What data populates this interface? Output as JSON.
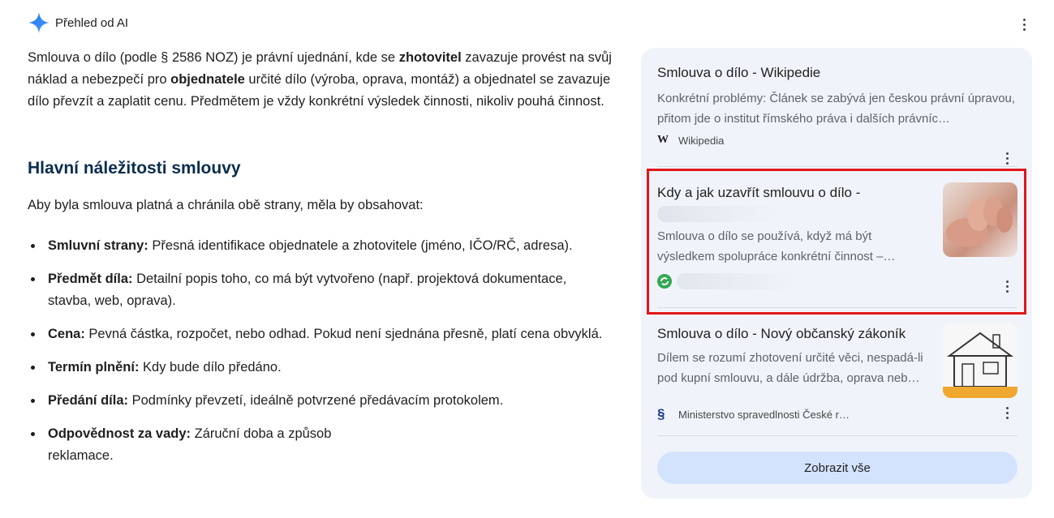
{
  "header": {
    "title": "Přehled od AI",
    "icon": "ai-sparkle-icon",
    "accent": "#4285f4"
  },
  "intro": {
    "p1": "Smlouva o dílo (podle § 2586 NOZ) je právní ujednání, kde se ",
    "b1": "zhotovitel",
    "p2": " zavazuje provést na svůj náklad a nebezpečí pro ",
    "b2": "objednatele",
    "p3": " určité dílo (výroba, oprava, montáž) a objednatel se zavazuje dílo převzít a zaplatit cenu. Předmětem je vždy konkrétní výsledek činnosti, nikoliv pouhá činnost."
  },
  "section": {
    "heading": "Hlavní náležitosti smlouvy",
    "subtitle": "Aby byla smlouva platná a chránila obě strany, měla by obsahovat:",
    "items": [
      {
        "term": "Smluvní strany:",
        "text": " Přesná identifikace objednatele a zhotovitele (jméno, IČO/RČ, adresa)."
      },
      {
        "term": "Předmět díla:",
        "text": " Detailní popis toho, co má být vytvořeno (např. projektová dokumentace, stavba, web, oprava)."
      },
      {
        "term": "Cena:",
        "text": " Pevná částka, rozpočet, nebo odhad. Pokud není sjednána přesně, platí cena obvyklá."
      },
      {
        "term": "Termín plnění:",
        "text": " Kdy bude dílo předáno."
      },
      {
        "term": "Předání díla:",
        "text": " Podmínky převzetí, ideálně potvrzené předávacím protokolem."
      },
      {
        "term": "Odpovědnost za vady:",
        "text": " Záruční doba a způsob reklamace."
      }
    ]
  },
  "sources": {
    "cards": [
      {
        "title": "Smlouva o dílo - Wikipedie",
        "snippet": "Konkrétní problémy: Článek se zabývá jen českou právní úpravou, přitom jde o institut římského práva i dalších právníc…",
        "source": "Wikipedia",
        "icon": "wikipedia-icon"
      },
      {
        "title": "Kdy a jak uzavřít smlouvu o dílo -",
        "snippet": "Smlouva o dílo se používá, když má být výsledkem spolupráce konkrétní činnost –…",
        "source": "",
        "icon": "green-source-icon"
      },
      {
        "title": "Smlouva o dílo - Nový občanský zákoník",
        "snippet": "Dílem se rozumí zhotovení určité věci, nespadá-li pod kupní smlouvu, a dále údržba, oprava neb…",
        "source": "Ministerstvo spravedlnosti České r…",
        "icon": "paragraph-icon"
      }
    ],
    "show_all": "Zobrazit vše",
    "highlight_color": "#e2161b",
    "button_color": "#d3e3fd"
  }
}
